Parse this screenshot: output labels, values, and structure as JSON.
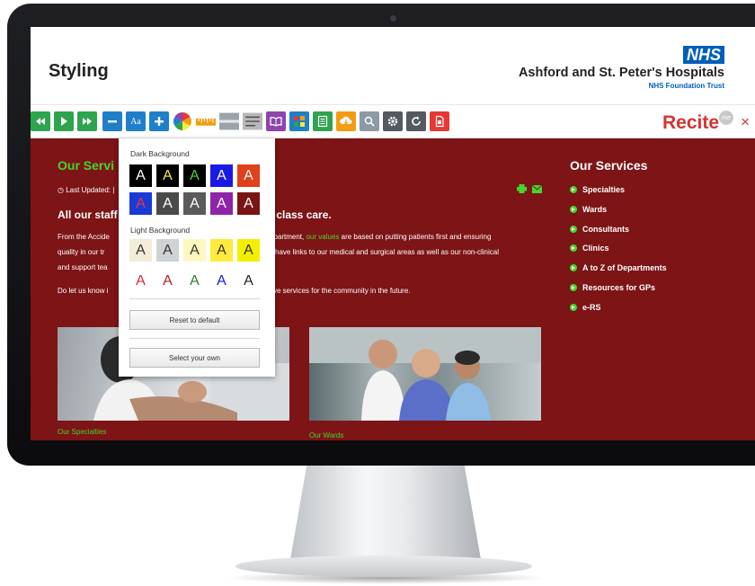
{
  "header": {
    "page_title": "Styling",
    "nhs_logo": "NHS",
    "org_name": "Ashford and St. Peter's Hospitals",
    "org_sub": "NHS Foundation Trust"
  },
  "toolbar": {
    "brand": "Recite",
    "brand_badge": "me",
    "close": "×",
    "font_button": "Aa",
    "buttons": [
      "rewind-icon",
      "play-icon",
      "fast-forward-icon",
      "decrease-text-icon",
      "font-icon",
      "increase-text-icon",
      "colour-wheel-icon",
      "ruler-icon",
      "screen-mask-icon",
      "dictionary-icon",
      "translate-icon",
      "reader-icon",
      "download-audio-icon",
      "magnifier-icon",
      "settings-icon",
      "reset-icon",
      "pdf-icon"
    ],
    "colors": {
      "green": "#2ea44f",
      "blue": "#1f7fc9",
      "grey": "#8c9aa6",
      "red": "#e53935",
      "orange": "#f39c12",
      "purple": "#8e44ad"
    }
  },
  "main": {
    "services_heading": "Our Servi",
    "last_updated": "Last Updated: |",
    "intro_heading_a": "All our staff",
    "intro_heading_b": "t class care.",
    "para1_line1_a": "From the Accide",
    "para1_line1_b": "epartment,",
    "para1_line1_link": "our values",
    "para1_line1_c": "are based on putting patients first and ensuring",
    "para1_line2_a": "quality in our tr",
    "para1_line2_b": "have links to our medical and surgical areas as well as our non-clinical",
    "para1_line3_a": "and support tea",
    "para2_a": "Do let us know i",
    "para2_b": "ve services for the community in the future.",
    "caption_left": "Our Specialties",
    "caption_right": "Our Wards"
  },
  "sidebar": {
    "title": "Our Services",
    "items": [
      "Specialties",
      "Wards",
      "Consultants",
      "Clinics",
      "A to Z of Departments",
      "Resources for GPs",
      "e-RS"
    ]
  },
  "popup": {
    "dark_label": "Dark Background",
    "light_label": "Light Background",
    "letter": "A",
    "reset_label": "Reset to default",
    "select_label": "Select your own",
    "dark_row1": [
      {
        "bg": "#000000",
        "fg": "#ffffff"
      },
      {
        "bg": "#000000",
        "fg": "#ffeb3b"
      },
      {
        "bg": "#000000",
        "fg": "#44d62c"
      },
      {
        "bg": "#1a1ae6",
        "fg": "#ffffff"
      },
      {
        "bg": "#e0401a",
        "fg": "#ffffff"
      }
    ],
    "dark_row2": [
      {
        "bg": "#1a3ad8",
        "fg": "#e53935"
      },
      {
        "bg": "#4a4a4a",
        "fg": "#ffffff"
      },
      {
        "bg": "#5a5a5a",
        "fg": "#ffffff"
      },
      {
        "bg": "#8e24aa",
        "fg": "#ffffff"
      },
      {
        "bg": "#7a1414",
        "fg": "#ffffff"
      }
    ],
    "light_row1": [
      {
        "bg": "#f3ecd6",
        "fg": "#333333"
      },
      {
        "bg": "#cfd3d6",
        "fg": "#333333"
      },
      {
        "bg": "#fff7c0",
        "fg": "#333333"
      },
      {
        "bg": "#ffeb3b",
        "fg": "#333333"
      },
      {
        "bg": "#f2f000",
        "fg": "#333333"
      }
    ],
    "light_row2": [
      {
        "bg": "#ffffff",
        "fg": "#d32f2f"
      },
      {
        "bg": "#ffffff",
        "fg": "#b71c1c"
      },
      {
        "bg": "#ffffff",
        "fg": "#2e7d32"
      },
      {
        "bg": "#ffffff",
        "fg": "#1a1ae6"
      },
      {
        "bg": "#ffffff",
        "fg": "#222222"
      }
    ]
  },
  "theme": {
    "maroon": "#7d1416",
    "accent_green": "#44d62c",
    "nhs_blue": "#005eb8",
    "recite_red": "#d43431"
  }
}
